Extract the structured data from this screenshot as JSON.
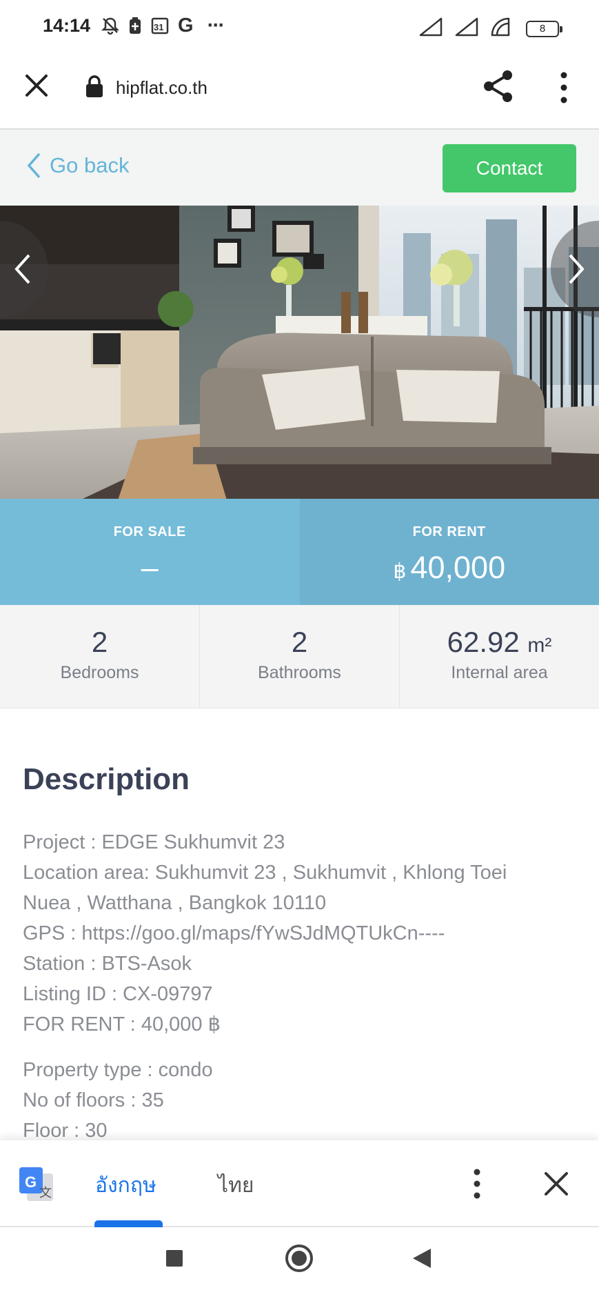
{
  "status_bar": {
    "time": "14:14",
    "calendar_day": "31",
    "google_letter": "G",
    "more": "···",
    "battery": "8"
  },
  "browser": {
    "url": "hipflat.co.th"
  },
  "header": {
    "back_label": "Go back",
    "contact_label": "Contact",
    "accent_color": "#43c76a",
    "link_color": "#64b5d9"
  },
  "prices": {
    "sale_label": "FOR SALE",
    "sale_value": "–",
    "rent_label": "FOR RENT",
    "rent_currency": "฿",
    "rent_value": "40,000"
  },
  "stats": [
    {
      "value": "2",
      "unit": "",
      "label": "Bedrooms"
    },
    {
      "value": "2",
      "unit": "",
      "label": "Bathrooms"
    },
    {
      "value": "62.92",
      "unit": "m²",
      "label": "Internal area"
    }
  ],
  "description": {
    "title": "Description",
    "group1": [
      "Project : EDGE Sukhumvit 23",
      "Location area: Sukhumvit 23 , Sukhumvit , Khlong Toei",
      "Nuea , Watthana , Bangkok 10110",
      "GPS : https://goo.gl/maps/fYwSJdMQTUkCn----",
      "Station : BTS-Asok",
      "Listing ID : CX-09797",
      "FOR RENT : 40,000 ฿"
    ],
    "group2": [
      "Property type : condo",
      "No of floors : 35",
      "Floor : 30"
    ]
  },
  "translate_bar": {
    "active_lang": "อังกฤษ",
    "inactive_lang": "ไทย"
  }
}
